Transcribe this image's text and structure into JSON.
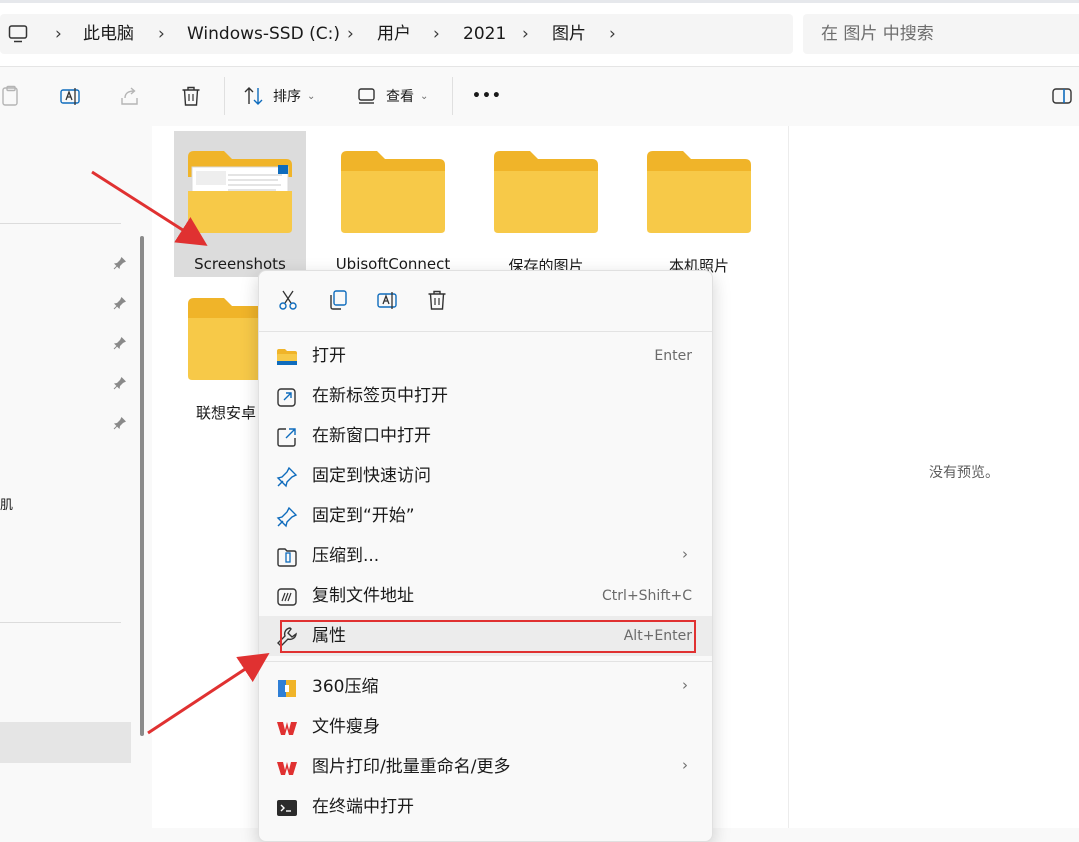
{
  "address_bar": {
    "breadcrumbs": [
      "此电脑",
      "Windows-SSD (C:)",
      "用户",
      "2021",
      "图片"
    ],
    "search_placeholder": "在 图片 中搜索"
  },
  "toolbar": {
    "sort_label": "排序",
    "view_label": "查看",
    "more_label": "•••"
  },
  "nav_pane": {
    "fragment": "肌"
  },
  "folders": [
    {
      "name": "Screenshots",
      "selected": true
    },
    {
      "name": "UbisoftConnect",
      "selected": false
    },
    {
      "name": "保存的图片",
      "selected": false
    },
    {
      "name": "本机照片",
      "selected": false
    },
    {
      "name": "联想安卓",
      "selected": false
    }
  ],
  "preview": {
    "text": "没有预览。"
  },
  "context_menu": {
    "quick_actions": [
      "cut-icon",
      "copy-icon",
      "rename-icon",
      "delete-icon"
    ],
    "items": [
      {
        "label": "打开",
        "shortcut": "Enter",
        "icon": "open-folder-icon",
        "submenu": false
      },
      {
        "label": "在新标签页中打开",
        "shortcut": "",
        "icon": "new-tab-icon",
        "submenu": false
      },
      {
        "label": "在新窗口中打开",
        "shortcut": "",
        "icon": "new-window-icon",
        "submenu": false
      },
      {
        "label": "固定到快速访问",
        "shortcut": "",
        "icon": "pin-icon",
        "submenu": false
      },
      {
        "label": "固定到“开始”",
        "shortcut": "",
        "icon": "pin-icon",
        "submenu": false
      },
      {
        "label": "压缩到...",
        "shortcut": "",
        "icon": "zip-icon",
        "submenu": true
      },
      {
        "label": "复制文件地址",
        "shortcut": "Ctrl+Shift+C",
        "icon": "copy-path-icon",
        "submenu": false
      },
      {
        "label": "属性",
        "shortcut": "Alt+Enter",
        "icon": "wrench-icon",
        "submenu": false
      },
      {
        "label": "360压缩",
        "shortcut": "",
        "icon": "360-zip-icon",
        "submenu": true
      },
      {
        "label": "文件瘦身",
        "shortcut": "",
        "icon": "wps-icon",
        "submenu": false
      },
      {
        "label": "图片打印/批量重命名/更多",
        "shortcut": "",
        "icon": "wps-icon",
        "submenu": true
      },
      {
        "label": "在终端中打开",
        "shortcut": "",
        "icon": "terminal-icon",
        "submenu": false
      }
    ]
  },
  "colors": {
    "folder": "#f7c948",
    "folder_tab": "#f0b429",
    "accent_blue": "#0f6cbd",
    "annotation_red": "#e03131"
  }
}
